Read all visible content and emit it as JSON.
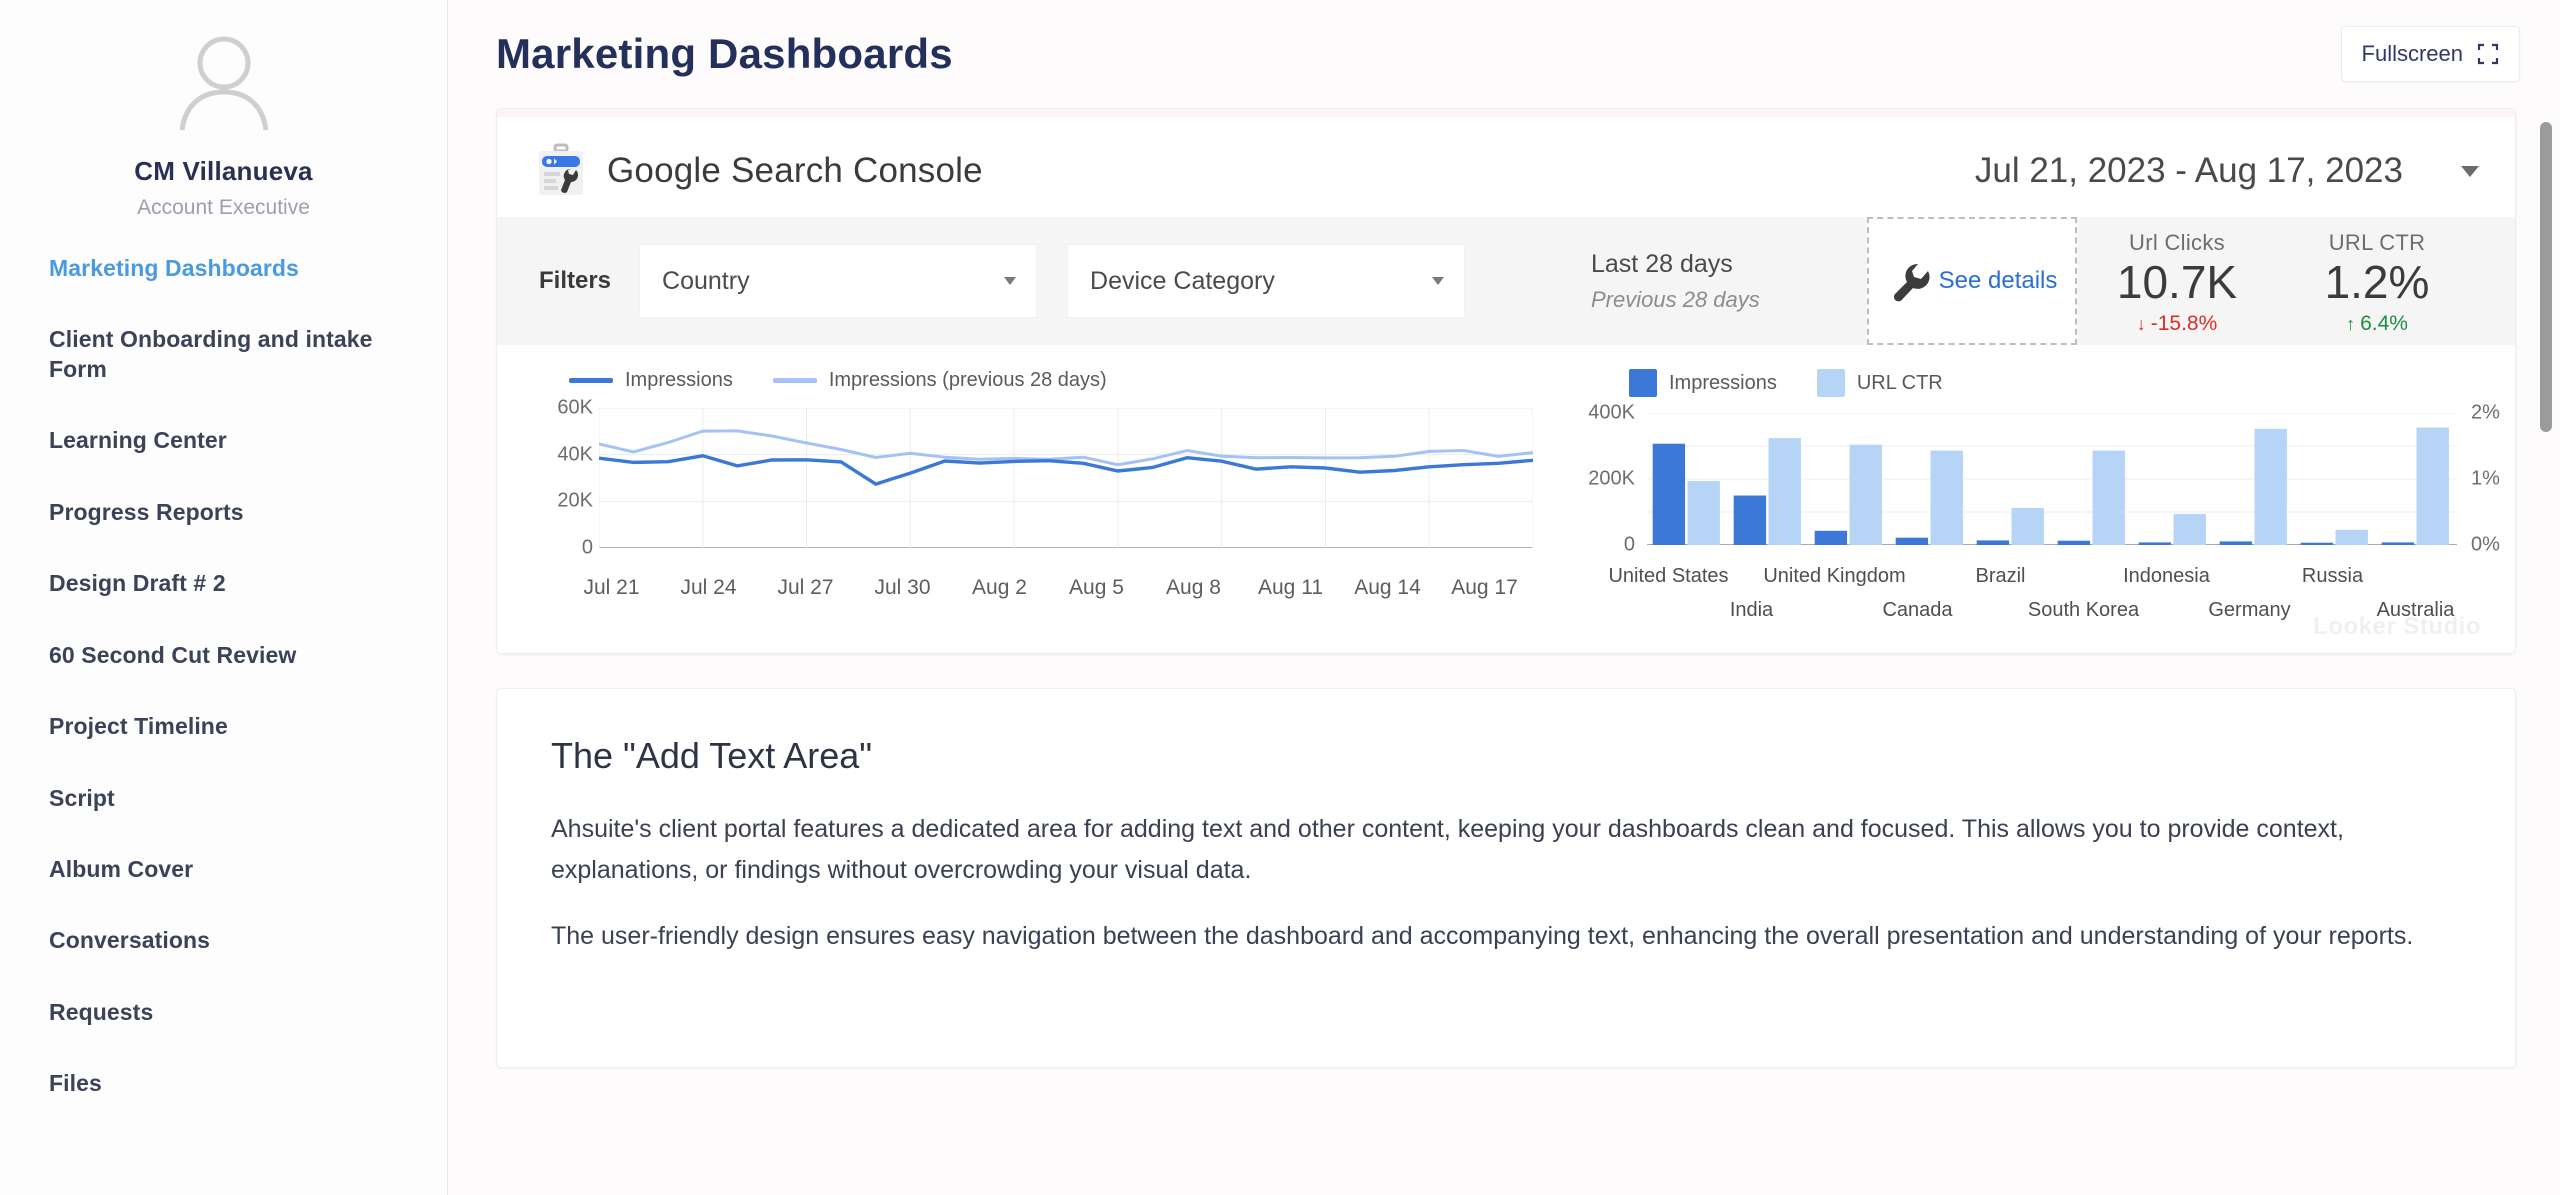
{
  "sidebar": {
    "user": {
      "name": "CM Villanueva",
      "role": "Account Executive"
    },
    "items": [
      {
        "label": "Marketing Dashboards",
        "active": true
      },
      {
        "label": "Client Onboarding and intake Form",
        "active": false
      },
      {
        "label": "Learning Center",
        "active": false
      },
      {
        "label": "Progress Reports",
        "active": false
      },
      {
        "label": "Design Draft # 2",
        "active": false
      },
      {
        "label": "60 Second Cut Review",
        "active": false
      },
      {
        "label": "Project Timeline",
        "active": false
      },
      {
        "label": "Script",
        "active": false
      },
      {
        "label": "Album Cover",
        "active": false
      },
      {
        "label": "Conversations",
        "active": false
      },
      {
        "label": "Requests",
        "active": false
      },
      {
        "label": "Files",
        "active": false
      }
    ]
  },
  "header": {
    "title": "Marketing Dashboards",
    "fullscreen_label": "Fullscreen"
  },
  "dashboard": {
    "source_title": "Google Search Console",
    "date_range": "Jul 21, 2023 - Aug 17, 2023",
    "filters": {
      "label": "Filters",
      "selects": [
        {
          "value": "Country"
        },
        {
          "value": "Device Category"
        }
      ]
    },
    "scorecards": {
      "period_current": "Last 28 days",
      "period_previous": "Previous 28 days",
      "see_details": "See details",
      "kpis": [
        {
          "label": "Url Clicks",
          "value": "10.7K",
          "delta": "-15.8%",
          "direction": "down",
          "arrow": "↓"
        },
        {
          "label": "URL CTR",
          "value": "1.2%",
          "delta": "6.4%",
          "direction": "up",
          "arrow": "↑"
        }
      ]
    },
    "watermark": "Looker Studio"
  },
  "chart_data": [
    {
      "type": "line",
      "title": "",
      "xlabel": "",
      "ylabel": "",
      "ylim": [
        0,
        60000
      ],
      "yticks": [
        0,
        20000,
        40000,
        60000
      ],
      "ytick_labels": [
        "0",
        "20K",
        "40K",
        "60K"
      ],
      "grid": true,
      "legend_position": "top-left",
      "x": [
        "Jul 21",
        "Jul 22",
        "Jul 23",
        "Jul 24",
        "Jul 25",
        "Jul 26",
        "Jul 27",
        "Jul 28",
        "Jul 29",
        "Jul 30",
        "Jul 31",
        "Aug 1",
        "Aug 2",
        "Aug 3",
        "Aug 4",
        "Aug 5",
        "Aug 6",
        "Aug 7",
        "Aug 8",
        "Aug 9",
        "Aug 10",
        "Aug 11",
        "Aug 12",
        "Aug 13",
        "Aug 14",
        "Aug 15",
        "Aug 16",
        "Aug 17"
      ],
      "xtick_labels": [
        "Jul 21",
        "Jul 24",
        "Jul 27",
        "Jul 30",
        "Aug 2",
        "Aug 5",
        "Aug 8",
        "Aug 11",
        "Aug 14",
        "Aug 17"
      ],
      "series": [
        {
          "name": "Impressions",
          "color": "#3c78d8",
          "values": [
            38500,
            36700,
            37000,
            39500,
            35200,
            37700,
            37800,
            36900,
            27400,
            32100,
            37300,
            36400,
            37100,
            37400,
            36300,
            33000,
            34500,
            38700,
            37200,
            33800,
            34800,
            34300,
            32500,
            33200,
            34800,
            35700,
            36300,
            37600
          ]
        },
        {
          "name": "Impressions (previous 28 days)",
          "color": "#a4c2f4",
          "values": [
            44600,
            41200,
            45200,
            50100,
            50200,
            48000,
            45000,
            42200,
            38800,
            40600,
            38900,
            38000,
            38400,
            38000,
            38900,
            35700,
            38200,
            41800,
            39400,
            38700,
            38800,
            38600,
            38700,
            39300,
            41400,
            41800,
            39300,
            40900
          ]
        }
      ]
    },
    {
      "type": "bar",
      "title": "",
      "grid": true,
      "legend_position": "top-left",
      "categories": [
        "United States",
        "India",
        "United Kingdom",
        "Canada",
        "Brazil",
        "South Korea",
        "Indonesia",
        "Germany",
        "Russia",
        "Australia"
      ],
      "y_left": {
        "label": "",
        "ylim": [
          0,
          400000
        ],
        "ticks": [
          0,
          200000,
          400000
        ],
        "tick_labels": [
          "0",
          "200K",
          "400K"
        ]
      },
      "y_right": {
        "label": "",
        "ylim": [
          0,
          2
        ],
        "ticks": [
          0,
          1,
          2
        ],
        "tick_labels": [
          "0%",
          "1%",
          "2%"
        ]
      },
      "series": [
        {
          "name": "Impressions",
          "color": "#3c78d8",
          "axis": "left",
          "values": [
            307000,
            150000,
            43000,
            22000,
            14000,
            13000,
            8000,
            11000,
            7000,
            8000
          ]
        },
        {
          "name": "URL CTR",
          "color": "#b6d4f5",
          "axis": "right",
          "values": [
            0.97,
            1.62,
            1.52,
            1.43,
            0.56,
            1.43,
            0.47,
            1.76,
            0.23,
            1.78
          ]
        }
      ]
    }
  ],
  "text_section": {
    "title": "The \"Add Text Area\"",
    "paragraphs": [
      "Ahsuite's client portal features a dedicated area for adding text and other content, keeping your dashboards clean and focused. This allows you to provide context, explanations, or findings without overcrowding your visual data.",
      "The user-friendly design ensures easy navigation between the dashboard and accompanying text, enhancing the overall presentation and understanding of your reports."
    ]
  },
  "colors": {
    "accent": "#4a9ae0",
    "title": "#23305c",
    "series_primary": "#3c78d8",
    "series_secondary": "#a4c2f4",
    "positive": "#1e8e3e",
    "negative": "#d93025"
  }
}
